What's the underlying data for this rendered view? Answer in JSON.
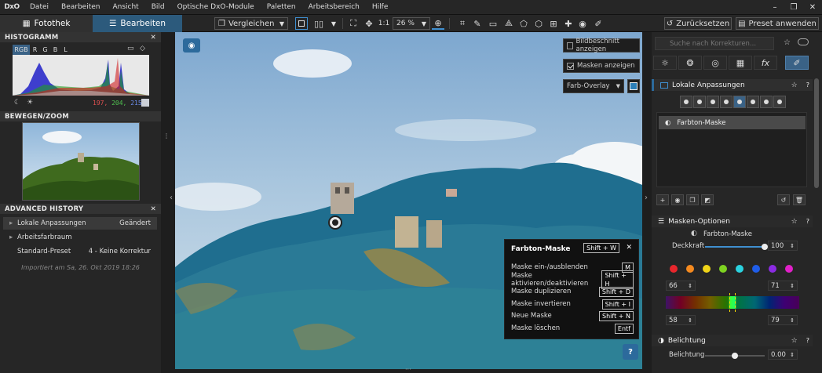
{
  "menubar": {
    "logo": "DxO",
    "items": [
      "Datei",
      "Bearbeiten",
      "Ansicht",
      "Bild",
      "Optische DxO-Module",
      "Paletten",
      "Arbeitsbereich",
      "Hilfe"
    ],
    "window_buttons": [
      "–",
      "❐",
      "✕"
    ]
  },
  "toolbar": {
    "tab_photolib": "Fotothek",
    "tab_edit": "Bearbeiten",
    "compare": "Vergleichen",
    "zoom_1to1": "1:1",
    "zoom_value": "26 %",
    "reset": "Zurücksetzen",
    "apply_preset": "Preset anwenden"
  },
  "left": {
    "histogram": {
      "title": "HISTOGRAMM",
      "tabs": [
        "RGB",
        "R",
        "G",
        "B",
        "L"
      ],
      "active_tab": "RGB",
      "values": {
        "r": "197,",
        "g": "204,",
        "b": "215"
      }
    },
    "navigator": {
      "title": "BEWEGEN/ZOOM"
    },
    "history": {
      "title": "ADVANCED HISTORY",
      "rows": [
        {
          "label": "Lokale Anpassungen",
          "right": "Geändert",
          "expander": "▸"
        },
        {
          "label": "Arbeitsfarbraum",
          "right": "",
          "expander": "▸"
        },
        {
          "label": "Standard-Preset",
          "right": "4 - Keine Korrektur",
          "expander": ""
        }
      ],
      "imported": "Importiert am Sa, 26. Okt 2019 18:26"
    }
  },
  "viewer": {
    "show_crop": "Bildbeschnitt anzeigen",
    "show_masks": "Masken anzeigen",
    "overlay": "Farb-Overlay",
    "popup": {
      "title": "Farbton-Maske",
      "title_shortcut": "Shift + W",
      "rows": [
        {
          "label": "Maske ein-/ausblenden",
          "key": "M"
        },
        {
          "label": "Maske aktivieren/deaktivieren",
          "key": "Shift + H"
        },
        {
          "label": "Maske duplizieren",
          "key": "Shift + D"
        },
        {
          "label": "Maske invertieren",
          "key": "Shift + I"
        },
        {
          "label": "Neue Maske",
          "key": "Shift + N"
        },
        {
          "label": "Maske löschen",
          "key": "Entf"
        }
      ]
    },
    "help": "?"
  },
  "right": {
    "search_placeholder": "Suche nach Korrekturen...",
    "local_title": "Lokale Anpassungen",
    "mask_item": "Farbton-Maske",
    "mask_options": {
      "title": "Masken-Optionen",
      "subtitle": "Farbton-Maske",
      "opacity_label": "Deckkraft",
      "opacity_value": "100",
      "opacity": 1.0,
      "colors": [
        "#e8262c",
        "#f58a1f",
        "#f0d418",
        "#7ed321",
        "#2bd3e0",
        "#1f5de8",
        "#8b2be2",
        "#e020c8"
      ],
      "hue_low": "66",
      "hue_high": "71",
      "range_low": "58",
      "range_high": "79"
    },
    "exposure": {
      "title": "Belichtung",
      "label": "Belichtung",
      "value": "0.00",
      "level": 0.5
    }
  }
}
